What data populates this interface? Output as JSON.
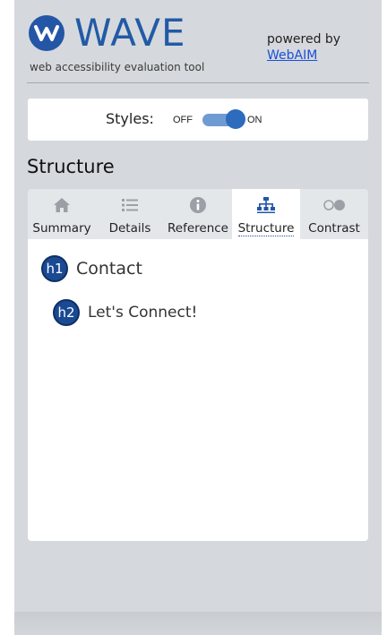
{
  "header": {
    "logo_text": "WAVE",
    "tagline": "web accessibility evaluation tool",
    "powered_by_label": "powered by",
    "powered_by_link": "WebAIM",
    "brand_color": "#2456a6"
  },
  "styles_toggle": {
    "label": "Styles:",
    "off_label": "OFF",
    "on_label": "ON",
    "state": "on"
  },
  "section_title": "Structure",
  "tabs": [
    {
      "label": "Summary",
      "icon": "home-icon",
      "active": false
    },
    {
      "label": "Details",
      "icon": "list-icon",
      "active": false
    },
    {
      "label": "Reference",
      "icon": "info-icon",
      "active": false
    },
    {
      "label": "Structure",
      "icon": "sitemap-icon",
      "active": true
    },
    {
      "label": "Contrast",
      "icon": "contrast-icon",
      "active": false
    }
  ],
  "structure": [
    {
      "level": "h1",
      "text": "Contact"
    },
    {
      "level": "h2",
      "text": "Let's Connect!"
    }
  ]
}
